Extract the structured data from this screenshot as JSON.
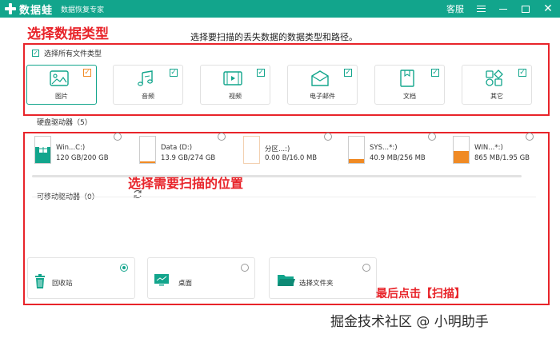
{
  "titlebar": {
    "logo_text": "数据蛙",
    "subtitle": "数据恢复专家",
    "support_label": "客服"
  },
  "annotations": {
    "select_type": "选择数据类型",
    "select_location": "选择需要扫描的位置",
    "click_scan": "最后点击【扫描】"
  },
  "instruction": "选择要扫描的丢失数据的数据类型和路径。",
  "select_all_label": "选择所有文件类型",
  "file_types": [
    {
      "label": "图片",
      "icon": "image-icon",
      "checked": true
    },
    {
      "label": "音频",
      "icon": "music-icon",
      "checked": true
    },
    {
      "label": "视频",
      "icon": "video-icon",
      "checked": true
    },
    {
      "label": "电子邮件",
      "icon": "email-icon",
      "checked": true
    },
    {
      "label": "文档",
      "icon": "document-icon",
      "checked": true
    },
    {
      "label": "其它",
      "icon": "other-icon",
      "checked": true
    }
  ],
  "hard_drives": {
    "label": "硬盘驱动器（5）",
    "drives": [
      {
        "name": "Win...C:)",
        "size": "120 GB/200 GB",
        "used_fraction": 0.6
      },
      {
        "name": "Data (D:)",
        "size": "13.9 GB/274 GB",
        "used_fraction": 0.05
      },
      {
        "name": "分区...:)",
        "size": "0.00  B/16.0 MB",
        "used_fraction": 0.0
      },
      {
        "name": "SYS...*:)",
        "size": "40.9 MB/256 MB",
        "used_fraction": 0.16
      },
      {
        "name": "WIN...*:)",
        "size": "865 MB/1.95 GB",
        "used_fraction": 0.44
      }
    ]
  },
  "removable": {
    "label": "可移动驱动器（0）"
  },
  "locations": [
    {
      "label": "回收站",
      "icon": "recycle-bin-icon",
      "selected": true
    },
    {
      "label": "桌面",
      "icon": "desktop-icon",
      "selected": false
    },
    {
      "label": "选择文件夹",
      "icon": "folder-icon",
      "selected": false
    }
  ],
  "watermark": "掘金技术社区 @ 小明助手",
  "colors": {
    "brand": "#12a58c",
    "annotation": "#e8242a",
    "drive_used": "#f08a24",
    "system_drive": "#12a58c"
  }
}
